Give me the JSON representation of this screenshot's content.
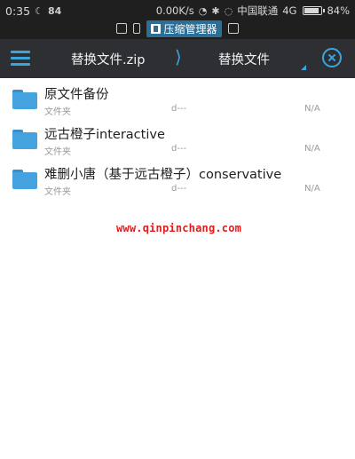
{
  "status_bar": {
    "time": "0:35",
    "left_glyph": "☾",
    "app_mark": "84",
    "network_speed": "0.00K/s",
    "carrier": "中国联通",
    "network_type": "4G",
    "battery_percent": "84%",
    "battery_level": 0.84,
    "notification_app": "压缩管理器"
  },
  "toolbar": {
    "breadcrumb": [
      "替换文件.zip",
      "替换文件"
    ],
    "separator": "⟩"
  },
  "files": [
    {
      "name": "原文件备份",
      "type": "文件夹",
      "permissions": "d---",
      "size": "N/A"
    },
    {
      "name": "远古橙子interactive",
      "type": "文件夹",
      "permissions": "d---",
      "size": "N/A"
    },
    {
      "name": "难删小唐（基于远古橙子）conservative",
      "type": "文件夹",
      "permissions": "d---",
      "size": "N/A"
    }
  ],
  "watermark": "www.qinpinchang.com",
  "colors": {
    "accent": "#3aa6df",
    "toolbar_bg": "#2e2f33",
    "status_bg": "#1f1f1f",
    "folder": "#44a3de",
    "watermark": "#e21b1b"
  }
}
